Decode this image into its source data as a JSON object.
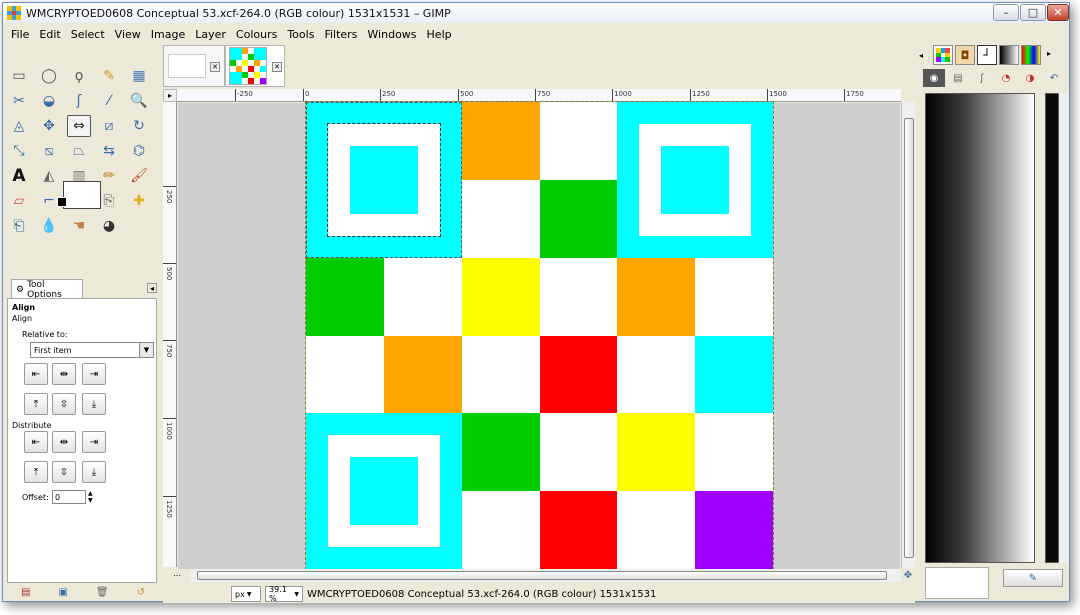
{
  "window": {
    "title": "WMCRYPTOED0608 Conceptual 53.xcf-264.0 (RGB colour) 1531x1531 – GIMP",
    "controls": [
      "–",
      "□",
      "✕"
    ]
  },
  "menu": [
    "File",
    "Edit",
    "Select",
    "View",
    "Image",
    "Layer",
    "Colours",
    "Tools",
    "Filters",
    "Windows",
    "Help"
  ],
  "toolbox": {
    "tools": [
      {
        "name": "rect-select-icon",
        "glyph": "▭",
        "color": "#555555"
      },
      {
        "name": "ellipse-select-icon",
        "glyph": "◯",
        "color": "#555555"
      },
      {
        "name": "free-select-icon",
        "glyph": "ϙ",
        "color": "#555555"
      },
      {
        "name": "fuzzy-select-icon",
        "glyph": "✎",
        "color": "#c9a020"
      },
      {
        "name": "color-select-icon",
        "glyph": "▦",
        "color": "#4a7ab8"
      },
      {
        "name": "scissors-icon",
        "glyph": "✂",
        "color": "#3a6ea5"
      },
      {
        "name": "foreground-select-icon",
        "glyph": "◒",
        "color": "#3a6ea5"
      },
      {
        "name": "paths-icon",
        "glyph": "ʃ",
        "color": "#3a6ea5"
      },
      {
        "name": "color-picker-icon",
        "glyph": "⁄",
        "color": "#3a6ea5"
      },
      {
        "name": "zoom-icon",
        "glyph": "🔍",
        "color": "#3a6ea5"
      },
      {
        "name": "measure-icon",
        "glyph": "◬",
        "color": "#3a6ea5"
      },
      {
        "name": "move-icon",
        "glyph": "✥",
        "color": "#3a6ea5"
      },
      {
        "name": "align-icon",
        "glyph": "⇔",
        "color": "#222222"
      },
      {
        "name": "crop-icon",
        "glyph": "⧄",
        "color": "#3a6ea5"
      },
      {
        "name": "rotate-icon",
        "glyph": "↻",
        "color": "#3a6ea5"
      },
      {
        "name": "scale-icon",
        "glyph": "⤡",
        "color": "#3a6ea5"
      },
      {
        "name": "shear-icon",
        "glyph": "⧅",
        "color": "#3a6ea5"
      },
      {
        "name": "perspective-icon",
        "glyph": "⏢",
        "color": "#3a6ea5"
      },
      {
        "name": "flip-icon",
        "glyph": "⇆",
        "color": "#3a6ea5"
      },
      {
        "name": "cage-icon",
        "glyph": "⌬",
        "color": "#3a6ea5"
      },
      {
        "name": "text-icon",
        "glyph": "A",
        "color": "#111111"
      },
      {
        "name": "bucket-fill-icon",
        "glyph": "◭",
        "color": "#666666"
      },
      {
        "name": "blend-icon",
        "glyph": "▥",
        "color": "#777777"
      },
      {
        "name": "pencil-icon",
        "glyph": "✏",
        "color": "#c08020"
      },
      {
        "name": "paintbrush-icon",
        "glyph": "🖌",
        "color": "#b05020"
      },
      {
        "name": "eraser-icon",
        "glyph": "▱",
        "color": "#d04a4a"
      },
      {
        "name": "airbrush-icon",
        "glyph": "⌐",
        "color": "#3a6ea5"
      },
      {
        "name": "ink-icon",
        "glyph": "✒",
        "color": "#333333"
      },
      {
        "name": "clone-icon",
        "glyph": "⎘",
        "color": "#666666"
      },
      {
        "name": "heal-icon",
        "glyph": "✚",
        "color": "#e0b020"
      },
      {
        "name": "perspective-clone-icon",
        "glyph": "⎗",
        "color": "#3a6ea5"
      },
      {
        "name": "blur-icon",
        "glyph": "💧",
        "color": "#3a6ea5"
      },
      {
        "name": "smudge-icon",
        "glyph": "☚",
        "color": "#c08050"
      },
      {
        "name": "dodge-burn-icon",
        "glyph": "◕",
        "color": "#333333"
      }
    ]
  },
  "tool_options": {
    "tab_label": "Tool Options",
    "title": "Align",
    "subtitle": "Align",
    "relative_to_label": "Relative to:",
    "relative_to_value": "First item",
    "distribute_label": "Distribute",
    "offset_label": "Offset:",
    "offset_value": "0",
    "align_row1": [
      "⇤",
      "⇹",
      "⇥"
    ],
    "align_row2": [
      "⤒",
      "⇳",
      "⤓"
    ],
    "dist_row1": [
      "⇤",
      "⇹",
      "⇥"
    ],
    "dist_row2": [
      "⤒",
      "⇳",
      "⤓"
    ]
  },
  "rulers": {
    "h_labels": [
      "-250",
      "0",
      "250",
      "500",
      "750",
      "1000",
      "1250",
      "1500",
      "1750"
    ],
    "v_labels": [
      "250",
      "500",
      "750",
      "1000",
      "1250"
    ]
  },
  "image_grid": {
    "rows": [
      [
        "#00ffff",
        "#00ffff",
        "#ffa500",
        "#ffffff",
        "#00ffff",
        "#00ffff"
      ],
      [
        "#00ffff",
        "#00ffff",
        "#ffffff",
        "#00cc00",
        "#00ffff",
        "#00ffff"
      ],
      [
        "#00cc00",
        "#ffffff",
        "#ffff00",
        "#ffffff",
        "#ffa500",
        "#ffffff"
      ],
      [
        "#ffffff",
        "#ffa500",
        "#ffffff",
        "#ff0000",
        "#ffffff",
        "#00ffff"
      ],
      [
        "#00ffff",
        "#00ffff",
        "#00cc00",
        "#ffffff",
        "#ffff00",
        "#ffffff"
      ],
      [
        "#00ffff",
        "#00ffff",
        "#ffffff",
        "#ff0000",
        "#ffffff",
        "#a000ff"
      ]
    ],
    "finder_color": "#00ffff",
    "finder_ring": "#ffffff"
  },
  "status": {
    "unit": "px",
    "zoom": "39.1 %",
    "text": "WMCRYPTOED0608 Conceptual 53.xcf-264.0 (RGB colour) 1531x1531"
  },
  "right_panel": {
    "tabs": [
      "pattern-tab",
      "brush-tab",
      "tool-preset-tab",
      "gradient-tab",
      "palette-tab"
    ]
  }
}
